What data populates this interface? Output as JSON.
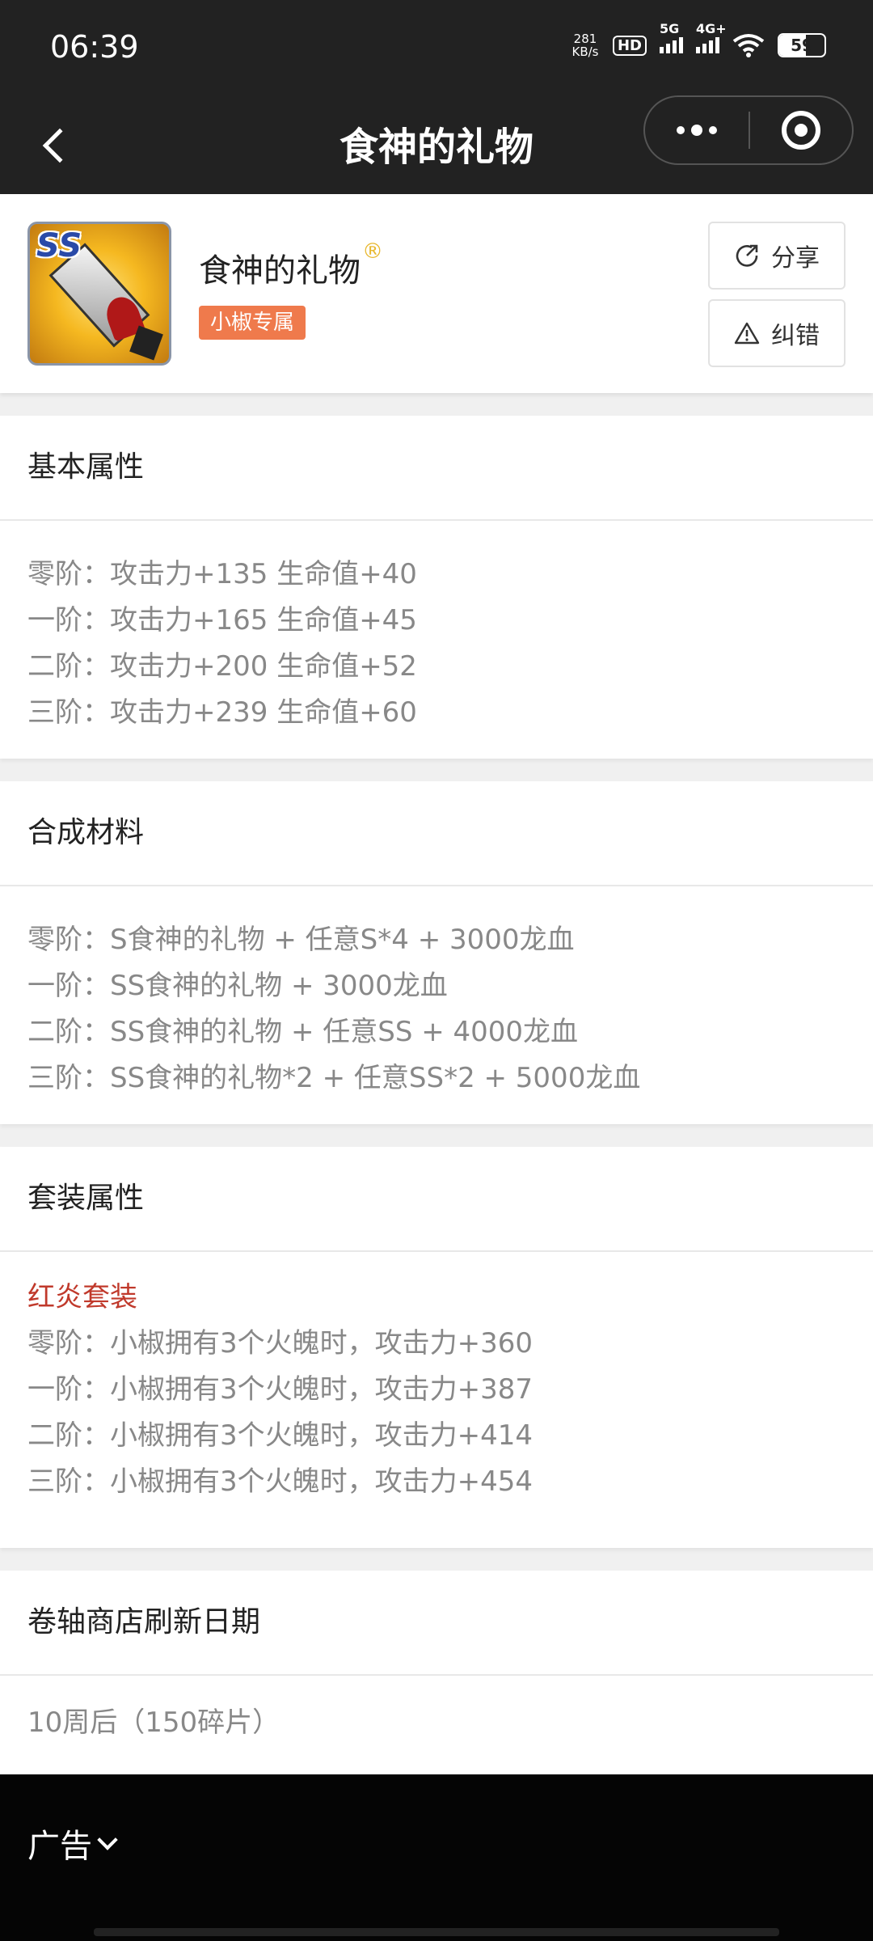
{
  "status_bar": {
    "time": "06:39",
    "net_speed_value": "281",
    "net_speed_unit": "KB/s",
    "hd_label": "HD",
    "signal_1_label": "5G",
    "signal_2_label": "4G+",
    "battery_level": "59",
    "battery_percent": 59
  },
  "navbar": {
    "title": "食神的礼物",
    "back_icon": "chevron-left-icon",
    "more_icon": "more-dots-icon",
    "close_icon": "target-icon"
  },
  "item": {
    "name": "食神的礼物",
    "reg_mark": "®",
    "tag": "小椒专属",
    "icon_text": "SS",
    "share_label": "分享",
    "share_icon": "share-icon",
    "report_label": "纠错",
    "report_icon": "warning-icon",
    "tag_color": "#ef7a4c"
  },
  "sections": {
    "basic": {
      "title": "基本属性",
      "lines": [
        "零阶：攻击力+135 生命值+40",
        "一阶：攻击力+165 生命值+45",
        "二阶：攻击力+200 生命值+52",
        "三阶：攻击力+239 生命值+60"
      ]
    },
    "materials": {
      "title": "合成材料",
      "lines": [
        "零阶：S食神的礼物 + 任意S*4 + 3000龙血",
        "一阶：SS食神的礼物 + 3000龙血",
        "二阶：SS食神的礼物 + 任意SS + 4000龙血",
        "三阶：SS食神的礼物*2 + 任意SS*2 + 5000龙血"
      ]
    },
    "set": {
      "title": "套装属性",
      "set_name": "红炎套装",
      "set_name_color": "#c0392b",
      "lines": [
        "零阶：小椒拥有3个火魄时，攻击力+360",
        "一阶：小椒拥有3个火魄时，攻击力+387",
        "二阶：小椒拥有3个火魄时，攻击力+414",
        "三阶：小椒拥有3个火魄时，攻击力+454"
      ]
    },
    "shop": {
      "title": "卷轴商店刷新日期",
      "text": "10周后（150碎片）"
    }
  },
  "ad": {
    "label": "广告",
    "chevron_icon": "chevron-down-icon"
  }
}
